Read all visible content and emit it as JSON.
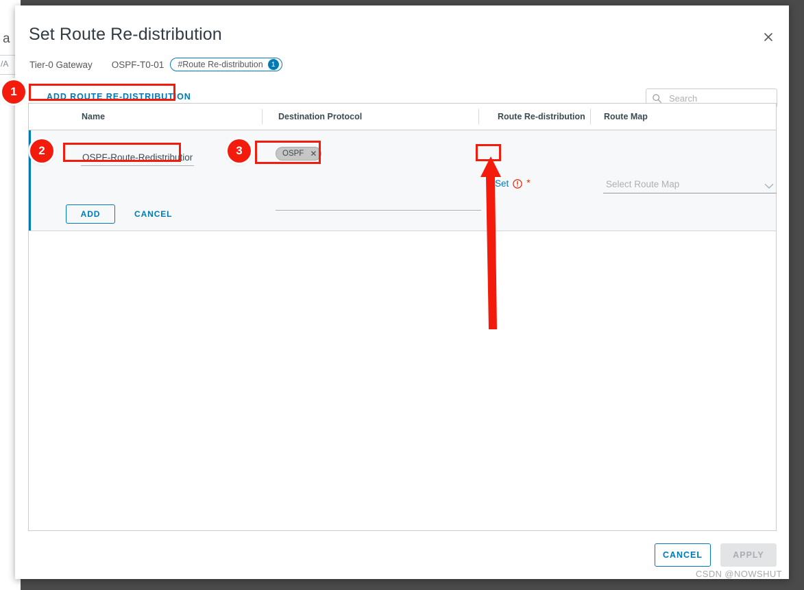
{
  "background": {
    "letter": "a",
    "small_text": "/A"
  },
  "dialog": {
    "title": "Set Route Re-distribution",
    "close_icon": "close-icon",
    "breadcrumb": {
      "gateway_label": "Tier-0 Gateway",
      "gateway_name": "OSPF-T0-01",
      "tag_label": "#Route Re-distribution",
      "tag_count": "1"
    },
    "add_link_label": "ADD ROUTE RE-DISTRIBUTION",
    "search": {
      "icon": "search-icon",
      "placeholder": "Search",
      "value": ""
    },
    "table": {
      "columns": [
        "Name",
        "Destination Protocol",
        "Route Re-distribution",
        "Route Map"
      ],
      "edit_row": {
        "name_value": "OSPF-Route-Redistribution",
        "protocol_chips": [
          {
            "label": "OSPF",
            "remove_icon": "close-icon"
          }
        ],
        "route_redistribution_link": "Set",
        "route_redistribution_warning_icon": "warning-circle-icon",
        "route_redistribution_required_marker": "*",
        "route_map_placeholder": "Select Route Map",
        "route_map_chevron_icon": "chevron-down-icon",
        "add_button_label": "ADD",
        "cancel_button_label": "CANCEL"
      }
    },
    "footer": {
      "cancel_label": "CANCEL",
      "apply_label": "APPLY"
    }
  },
  "annotations": {
    "badges": [
      {
        "number": "1",
        "target": "add-route-re-distribution-link"
      },
      {
        "number": "2",
        "target": "name-input"
      },
      {
        "number": "3",
        "target": "destination-protocol-chip"
      }
    ],
    "arrow": {
      "points_to": "Set",
      "color": "#f21b0c"
    }
  },
  "watermark": "CSDN @NOWSHUT",
  "colors": {
    "accent": "#0079b8",
    "annotation": "#f21b0c",
    "overlay": "#4a4a4a",
    "required": "#e02200"
  }
}
